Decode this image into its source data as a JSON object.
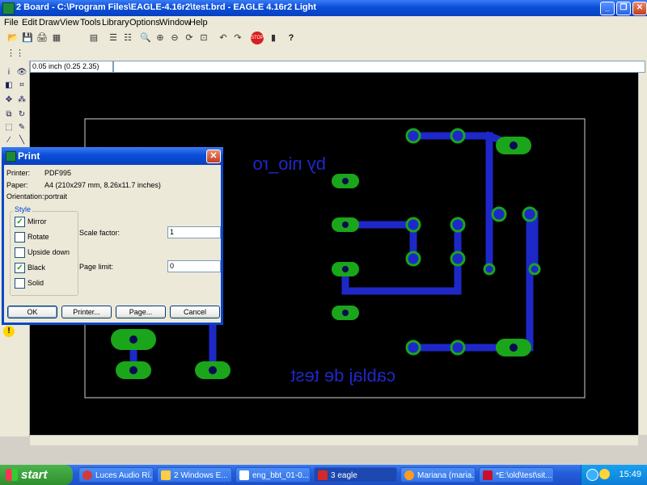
{
  "window": {
    "title": "2 Board - C:\\Program Files\\EAGLE-4.16r2\\test.brd - EAGLE 4.16r2 Light",
    "minimize_glyph": "_",
    "restore_glyph": "❐",
    "close_glyph": "✕"
  },
  "menu": {
    "items": [
      "File",
      "Edit",
      "Draw",
      "View",
      "Tools",
      "Library",
      "Options",
      "Window",
      "Help"
    ]
  },
  "toolbar": {
    "icons": [
      "open-icon",
      "save-icon",
      "print-icon",
      "cam-icon",
      "schematic-icon",
      "script-icon",
      "run-icon",
      "ulp-icon",
      "zoom-fit-icon",
      "zoom-in-icon",
      "zoom-out-icon",
      "zoom-redraw-icon",
      "zoom-window-icon",
      "undo-icon",
      "redo-icon",
      "stop-icon",
      "go-icon",
      "help-icon"
    ]
  },
  "status": {
    "grid_coord": "0.05 inch (0.25 2.35)",
    "command": ""
  },
  "board": {
    "mirrored_text_top": "by nio_ro",
    "mirrored_text_bottom": "cablaj de test",
    "trace_color": "#1e28c8",
    "pad_color": "#1aa51a",
    "outline_color": "#d0d0d0",
    "text_color": "#1e28c8"
  },
  "print_dialog": {
    "title": "Print",
    "printer_label": "Printer:",
    "printer_value": "PDF995",
    "paper_label": "Paper:",
    "paper_value": "A4 (210x297 mm, 8.26x11.7 inches)",
    "orientation_label": "Orientation:",
    "orientation_value": "portrait",
    "style_legend": "Style",
    "options": [
      {
        "label": "Mirror",
        "checked": true
      },
      {
        "label": "Rotate",
        "checked": false
      },
      {
        "label": "Upside down",
        "checked": false
      },
      {
        "label": "Black",
        "checked": true
      },
      {
        "label": "Solid",
        "checked": false
      }
    ],
    "scale_factor_label": "Scale factor:",
    "scale_factor_value": "1",
    "page_limit_label": "Page limit:",
    "page_limit_value": "0",
    "ok_label": "OK",
    "printer_button_label": "Printer...",
    "page_button_label": "Page...",
    "cancel_label": "Cancel"
  },
  "taskbar": {
    "start_label": "start",
    "buttons": [
      {
        "label": "Luces Audio Rí...",
        "active": false
      },
      {
        "label": "2 Windows E...",
        "active": false
      },
      {
        "label": "eng_bbt_01-0...",
        "active": false
      },
      {
        "label": "3 eagle",
        "active": true
      },
      {
        "label": "Mariana (maria...",
        "active": false
      },
      {
        "label": "*E:\\old\\test\\sit...",
        "active": false
      }
    ],
    "clock": "15:49"
  }
}
